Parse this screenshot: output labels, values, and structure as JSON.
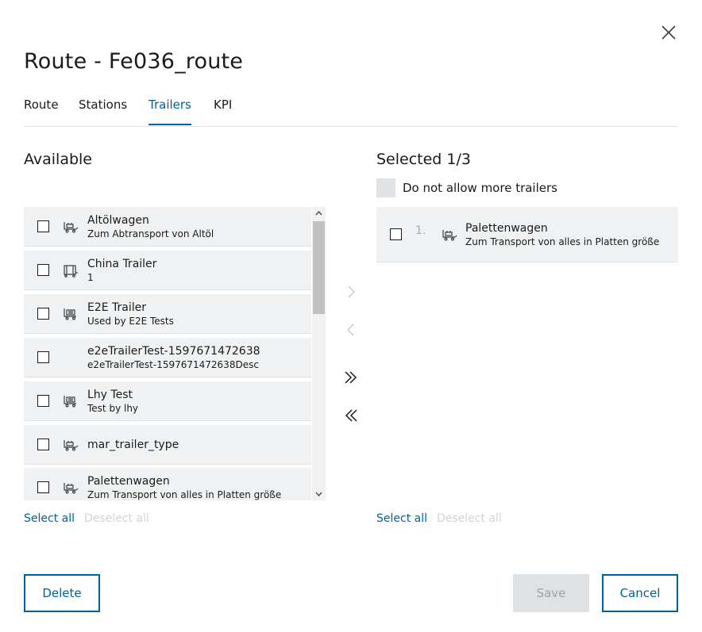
{
  "dialog": {
    "title": "Route - Fe036_route"
  },
  "tabs": [
    {
      "label": "Route",
      "active": false
    },
    {
      "label": "Stations",
      "active": false
    },
    {
      "label": "Trailers",
      "active": true
    },
    {
      "label": "KPI",
      "active": false
    }
  ],
  "available": {
    "title": "Available",
    "items": [
      {
        "name": "Altölwagen",
        "desc": "Zum Abtransport von Altöl",
        "icon": "wagon-icon",
        "checked": false
      },
      {
        "name": "China Trailer",
        "desc": "1",
        "icon": "frame-trailer-icon",
        "checked": false
      },
      {
        "name": "E2E Trailer",
        "desc": "Used by E2E Tests",
        "icon": "cart-trailer-icon",
        "checked": false
      },
      {
        "name": "e2eTrailerTest-1597671472638",
        "desc": "e2eTrailerTest-1597671472638Desc",
        "icon": "",
        "checked": false
      },
      {
        "name": "Lhy Test",
        "desc": "Test by lhy",
        "icon": "cart-trailer-icon",
        "checked": false
      },
      {
        "name": "mar_trailer_type",
        "desc": "",
        "icon": "wagon-icon",
        "checked": false
      },
      {
        "name": "Palettenwagen",
        "desc": "Zum Transport von alles in Platten größe",
        "icon": "wagon-icon",
        "checked": false
      }
    ],
    "select_all": "Select all",
    "deselect_all": "Deselect all"
  },
  "selected": {
    "title": "Selected 1/3",
    "dont_allow_label": "Do not allow more trailers",
    "dont_allow_checked": false,
    "items": [
      {
        "index": "1.",
        "name": "Palettenwagen",
        "desc": "Zum Transport von alles in Platten größe",
        "icon": "wagon-icon",
        "checked": false
      }
    ],
    "select_all": "Select all",
    "deselect_all": "Deselect all"
  },
  "transfer": {
    "move_right_enabled": false,
    "move_left_enabled": false,
    "move_all_right_enabled": true,
    "move_all_left_enabled": true
  },
  "buttons": {
    "delete": "Delete",
    "save": "Save",
    "cancel": "Cancel"
  },
  "colors": {
    "accent": "#00629a",
    "item_bg": "#eff1f2",
    "disabled_text": "#d0d4d8",
    "disabled_button_bg": "#dfe2e4"
  }
}
